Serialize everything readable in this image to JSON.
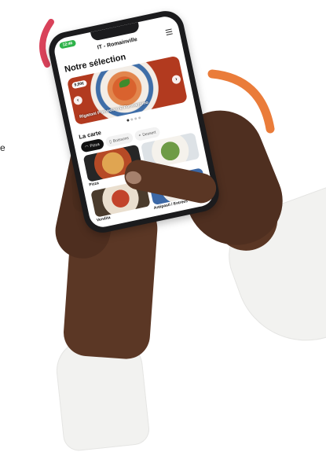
{
  "decor": {
    "accent_red": "#d9425a",
    "accent_orange": "#ea7c3a"
  },
  "page_edge_text": "e",
  "phone": {
    "status_badge": "12:46",
    "header": {
      "title": "IT - Romainville",
      "menu_icon": "hamburger-menu-icon"
    },
    "selection": {
      "title": "Notre sélection",
      "featured": {
        "price": "9,90€",
        "dish_name": "Rigatoni Pomodoro E Formaggino",
        "prev_icon": "chevron-left-icon",
        "next_icon": "chevron-right-icon"
      },
      "dots": 4,
      "active_dot": 0
    },
    "menu": {
      "title": "La carte",
      "tabs": [
        {
          "label": "Pizza",
          "icon": "pizza-icon",
          "active": true
        },
        {
          "label": "Boissons",
          "icon": "bottle-icon",
          "active": false
        },
        {
          "label": "Dessert",
          "icon": "dessert-icon",
          "active": false
        }
      ],
      "items": [
        {
          "label": "Pizza",
          "image": "pizza"
        },
        {
          "label": "",
          "image": "salad"
        },
        {
          "label": "Vendita",
          "image": "pasta"
        },
        {
          "label": "Antipasti / Entrées",
          "image": "antipasti"
        }
      ]
    }
  }
}
